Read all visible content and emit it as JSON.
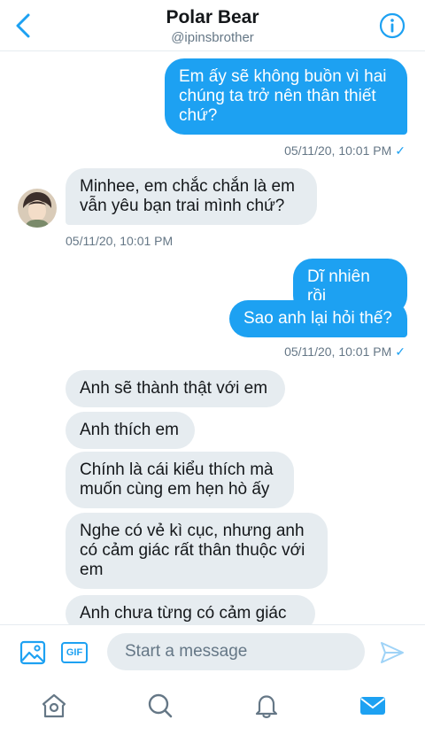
{
  "header": {
    "title": "Polar Bear",
    "handle": "@ipinsbrother"
  },
  "messages": [
    {
      "direction": "out",
      "text": "Em ấy sẽ không buồn vì hai\nchúng ta trở nên thân thiết\nchứ?"
    },
    {
      "direction": "out",
      "text": "05/11/20, 10:01 PM"
    },
    {
      "direction": "in",
      "text": "Minhee, em chắc chắn là em\nvẫn yêu bạn trai mình chứ?"
    },
    {
      "direction": "in",
      "text": "05/11/20, 10:01 PM"
    },
    {
      "direction": "out",
      "text": "Dĩ nhiên rồi"
    },
    {
      "direction": "out",
      "text": "Sao anh lại hỏi thế?"
    },
    {
      "direction": "out",
      "text": "05/11/20, 10:01 PM"
    },
    {
      "direction": "in",
      "text": "Anh sẽ thành thật với em"
    },
    {
      "direction": "in",
      "text": "Anh thích em"
    },
    {
      "direction": "in",
      "text": "Chính là cái kiểu thích mà\nmuốn cùng em hẹn hò ấy"
    },
    {
      "direction": "in",
      "text": "Nghe có vẻ kì cục, nhưng anh\ncó cảm giác rất thân thuộc với\nem"
    },
    {
      "direction": "in",
      "text": "Anh chưa từng có cảm giác"
    }
  ],
  "composer": {
    "gif_label": "GIF",
    "placeholder": "Start a message"
  },
  "colors": {
    "accent": "#1da1f2",
    "incoming_bubble": "#e6ecf0",
    "muted_text": "#657786"
  },
  "icons": {
    "back": "chevron-left-icon",
    "info": "info-icon",
    "media": "image-icon",
    "send": "send-icon",
    "home": "home-icon",
    "search": "search-icon",
    "notifications": "bell-icon",
    "messages": "mail-icon"
  }
}
